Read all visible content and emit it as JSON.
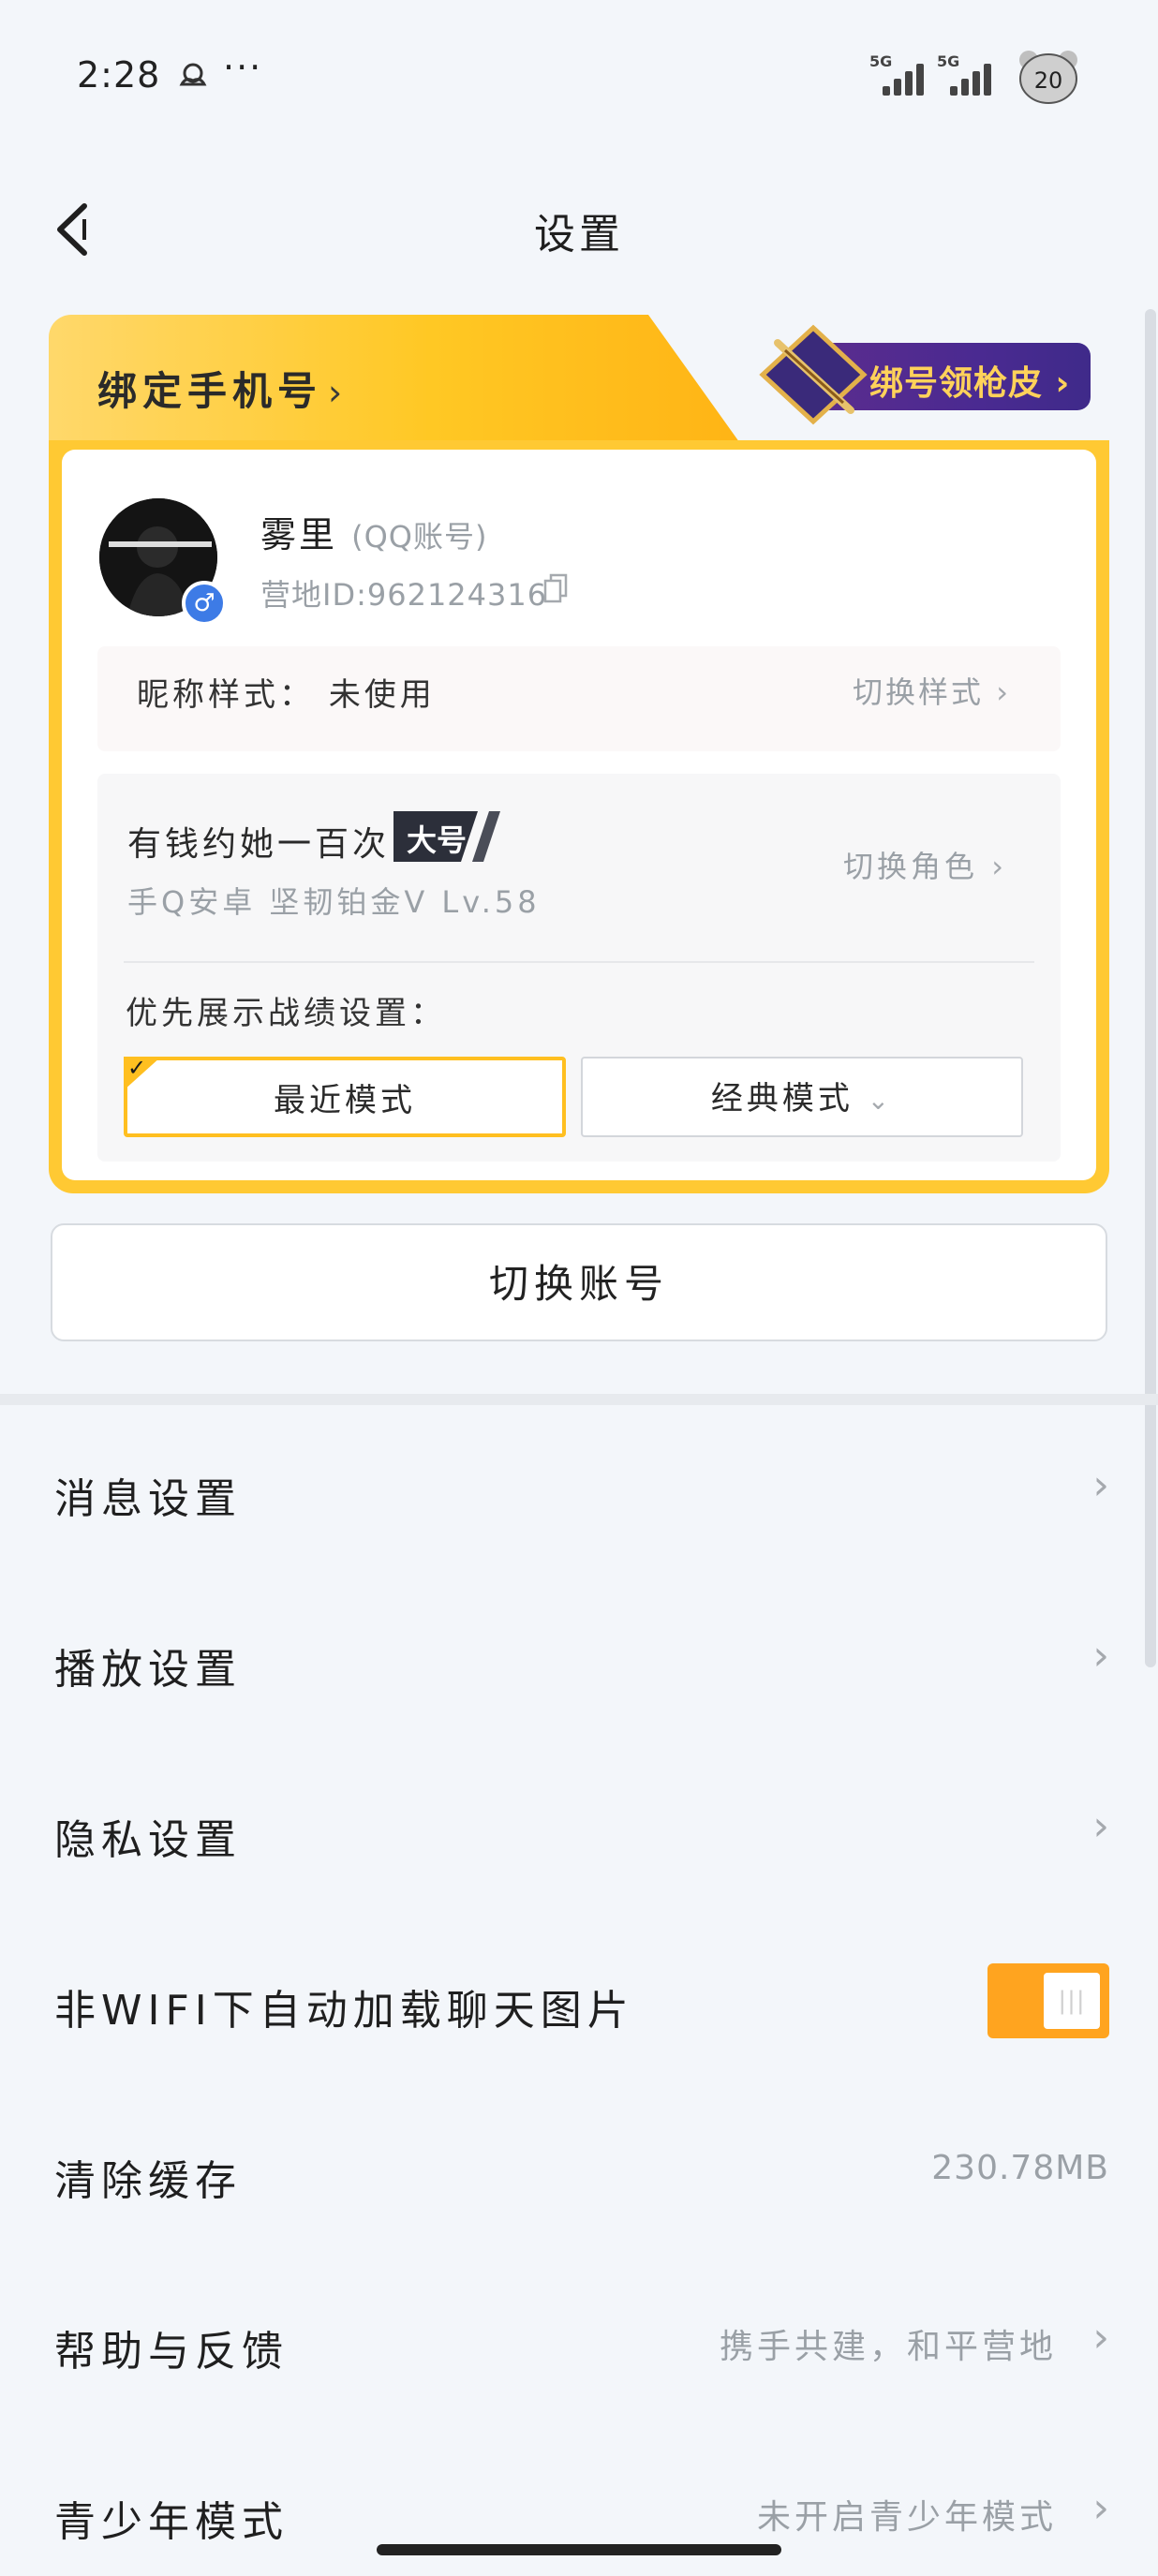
{
  "status_bar": {
    "time": "2:28",
    "more": "···",
    "network_1": "5G",
    "network_2": "5G",
    "avatar_badge": "20"
  },
  "header": {
    "title": "设置"
  },
  "profile_card": {
    "bind_phone": "绑定手机号",
    "bind_reward": "绑号领枪皮",
    "user_name": "雾里",
    "account_type": "(QQ账号)",
    "camp_id": "营地ID:962124316",
    "nickname_style_label": "昵称样式：",
    "nickname_style_value": "未使用",
    "switch_style": "切换样式",
    "role_name": "有钱约她一百次",
    "role_tag": "大号",
    "role_info": "手Q安卓 坚韧铂金Ⅴ Lv.58",
    "switch_role": "切换角色",
    "record_label": "优先展示战绩设置：",
    "mode_recent": "最近模式",
    "mode_classic": "经典模式",
    "mode_selected": "最近模式"
  },
  "switch_account": "切换账号",
  "menu": {
    "message_settings": "消息设置",
    "playback_settings": "播放设置",
    "privacy_settings": "隐私设置",
    "auto_load_images": "非WIFI下自动加载聊天图片",
    "auto_load_images_on": true,
    "clear_cache": "清除缓存",
    "cache_size": "230.78MB",
    "help_feedback": "帮助与反馈",
    "help_feedback_value": "携手共建，和平营地",
    "teen_mode": "青少年模式",
    "teen_mode_value": "未开启青少年模式"
  },
  "colors": {
    "accent_yellow": "#ffc933",
    "toggle_orange": "#ffa41f",
    "reward_purple": "#4a2a91",
    "gender_blue": "#3d7be6"
  }
}
